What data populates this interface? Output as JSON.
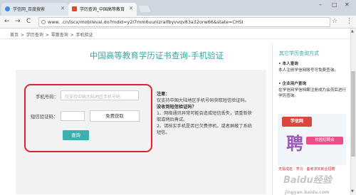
{
  "browser": {
    "tabs": [
      {
        "label": "学信网_百度搜索"
      },
      {
        "label": "学历查询_中国高等教育"
      }
    ],
    "url": "www.            .cn/lscx/mobileval.do?mdid=y2l7mm6uunlzralfbyvvqv83a32orw66&state=CHSI",
    "window_controls": {
      "minimize": "–",
      "maximize": "□",
      "close": "✕"
    },
    "nav": {
      "back": "←",
      "forward": "→",
      "reload": "C"
    },
    "star": "☆",
    "menu": "⋮"
  },
  "breadcrumb": [
    "首页",
    ">",
    "学历查询",
    ">",
    "零散查询",
    ">",
    "手机验证"
  ],
  "page": {
    "title": "中国高等教育学历证书查询-手机验证",
    "form": {
      "phone_label": "手机号码：",
      "phone_placeholder": "仅支持中国大陆地区手机号码",
      "code_label": "短信验证码：",
      "code_button": "免费获取",
      "submit": "查询"
    },
    "notes": {
      "heading": "注意：",
      "line1": "仅支持中国大陆地区手机号码获取短信验证码。",
      "heading2": "没收到短信验证码？",
      "item1": "1、网络通讯异常可能会造成短信丢失，请重新获取或稍后再试。",
      "item2": "2、请核实手机是否已欠费停机，或者屏蔽了系统短信。"
    }
  },
  "sidebar": {
    "title": "其它学历查询方式",
    "personal_heading": "• 本人查询",
    "personal_text": "本人注册学信网账号可免费查询。",
    "enterprise_heading": "• 企业用户查询",
    "enterprise_text": "在学信网学信档案注册成为会员后进行学历查询。",
    "ad_logo": "学信网",
    "ad_big": "聘",
    "ad_tag": "校园招聘会",
    "ad_foot": "无需成名 · 学习 · 备考求实就业招聘"
  },
  "watermark": {
    "text": "Baidu经验",
    "sub": "jingyan.baidu.com"
  },
  "colors": {
    "accent": "#3aa6a5",
    "highlight_box": "#e3212c",
    "button": "#3bb0b0"
  }
}
